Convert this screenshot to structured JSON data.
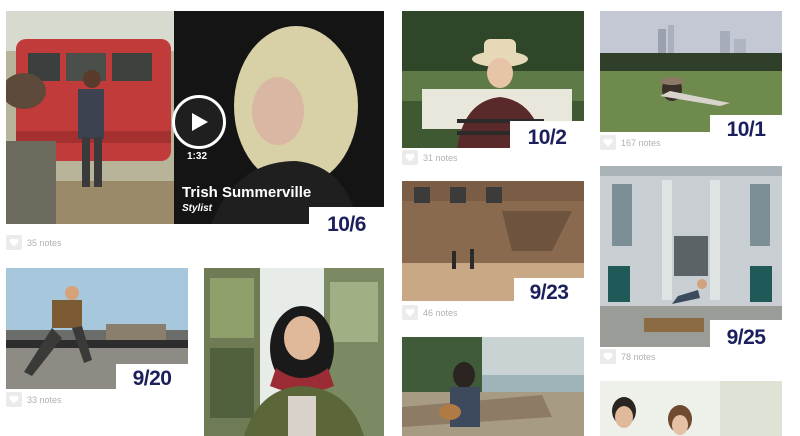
{
  "posts": {
    "video_stylist": {
      "date": "10/6",
      "notes": "35 notes",
      "video_name": "Trish Summerville",
      "video_role": "Stylist",
      "duration": "1:32"
    },
    "hat_portrait": {
      "date": "10/2",
      "notes": "31 notes"
    },
    "skyline_park": {
      "date": "10/1",
      "notes": "167 notes"
    },
    "warehouse_run": {
      "date": "9/23",
      "notes": "46 notes"
    },
    "building_jump": {
      "date": "9/25",
      "notes": "78 notes"
    },
    "rooftop_man": {
      "date": "9/20",
      "notes": "33 notes"
    },
    "woman_scarf": {},
    "beach_ukulele": {},
    "two_people": {}
  },
  "colors": {
    "date_text": "#1b1f5c",
    "notes_text": "#b0b0b0",
    "heart_bg": "#ebebeb"
  },
  "icons": {
    "heart": "heart-icon",
    "play": "play-icon"
  }
}
